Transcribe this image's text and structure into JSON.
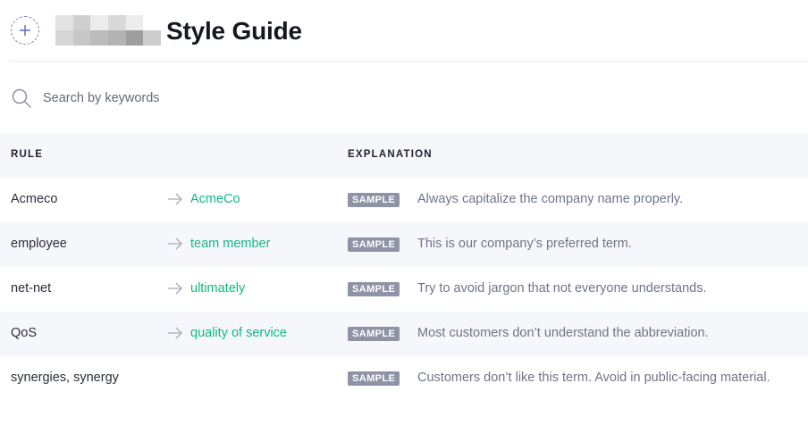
{
  "header": {
    "title": "Style Guide",
    "add_icon": "plus-circle-dashed-icon",
    "logo_blur_colors": [
      "#e3e3e3",
      "#cfcfcf",
      "#ececec",
      "#d9d9d9",
      "#ededed",
      "#ffffff",
      "#d6d6d6",
      "#c7c7c7",
      "#bcbcbc",
      "#b3b3b3",
      "#9e9e9e",
      "#cdcdcd"
    ]
  },
  "search": {
    "placeholder": "Search by keywords",
    "value": "",
    "icon": "search-icon"
  },
  "table": {
    "columns": {
      "rule": "RULE",
      "explanation": "EXPLANATION"
    },
    "rows": [
      {
        "rule": "Acmeco",
        "replacement": "AcmeCo",
        "badge": "SAMPLE",
        "explanation": "Always capitalize the company name properly."
      },
      {
        "rule": "employee",
        "replacement": "team member",
        "badge": "SAMPLE",
        "explanation": "This is our company’s preferred term."
      },
      {
        "rule": "net-net",
        "replacement": "ultimately",
        "badge": "SAMPLE",
        "explanation": "Try to avoid jargon that not everyone understands."
      },
      {
        "rule": "QoS",
        "replacement": "quality of service",
        "badge": "SAMPLE",
        "explanation": "Most customers don’t understand the abbreviation."
      },
      {
        "rule": "synergies, synergy",
        "replacement": "",
        "badge": "SAMPLE",
        "explanation": "Customers don’t like this term. Avoid in public-facing material."
      }
    ]
  },
  "colors": {
    "accent_green": "#12b886",
    "badge_gray": "#8e93a6",
    "row_alt": "#f6f7fb"
  }
}
